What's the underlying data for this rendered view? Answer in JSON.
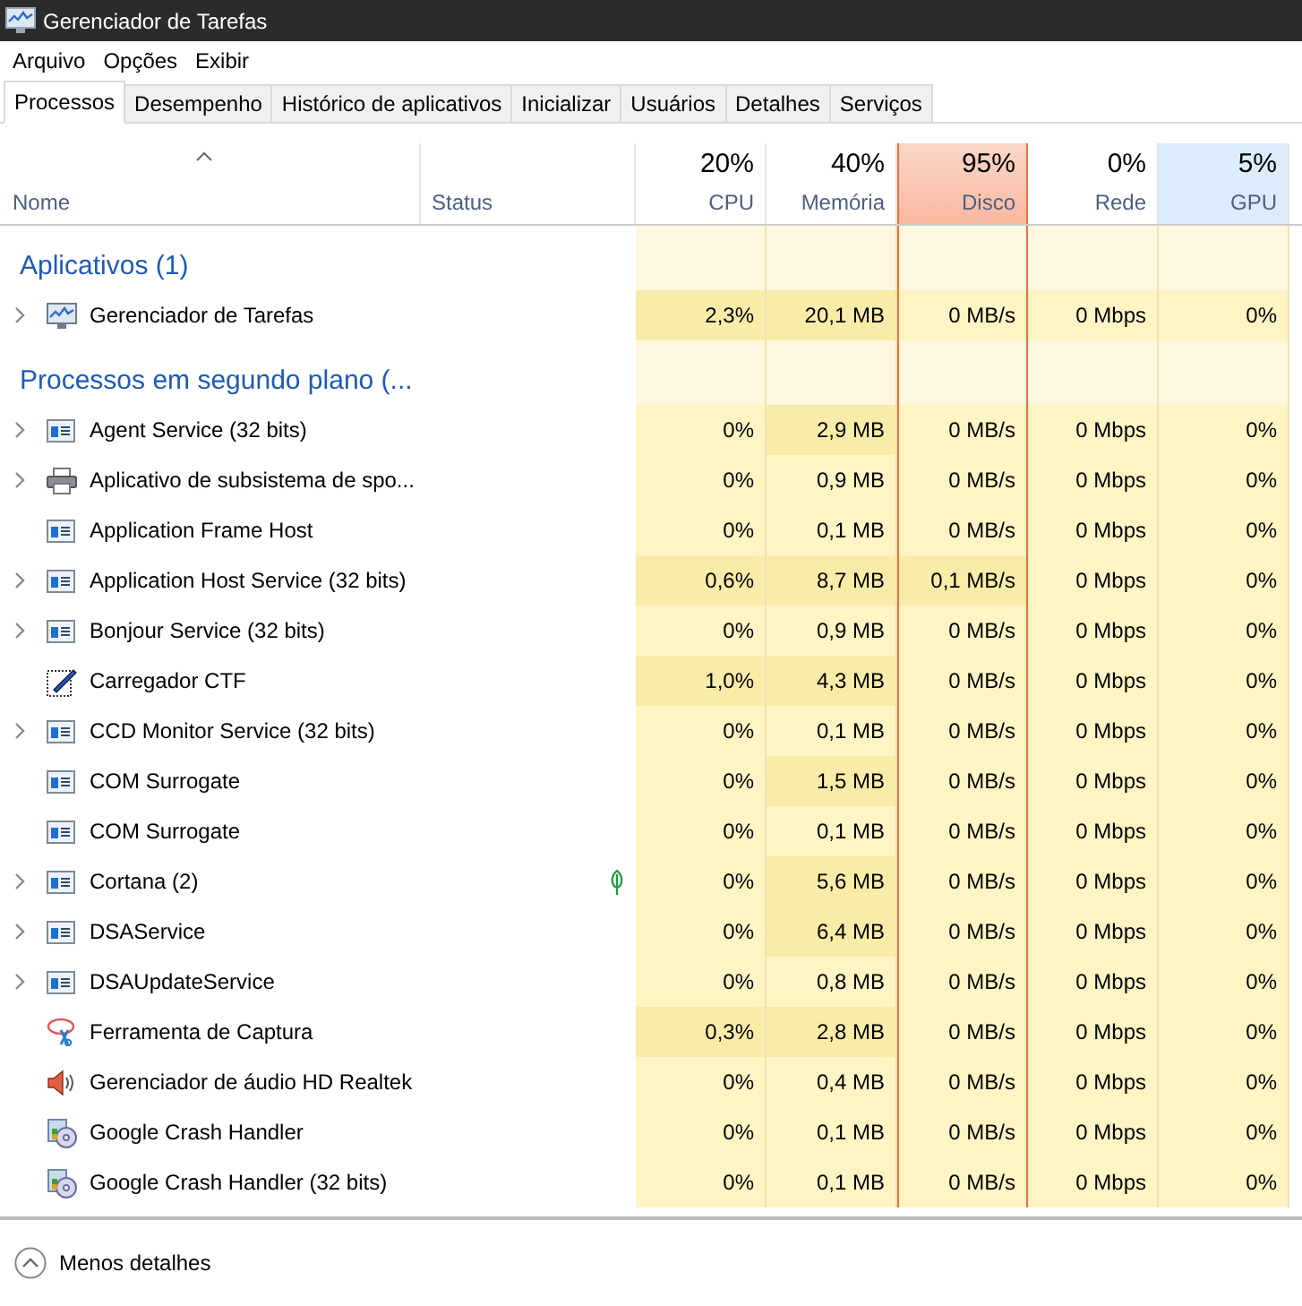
{
  "window": {
    "title": "Gerenciador de Tarefas"
  },
  "menu": [
    "Arquivo",
    "Opções",
    "Exibir"
  ],
  "tabs": [
    {
      "label": "Processos",
      "selected": true
    },
    {
      "label": "Desempenho",
      "selected": false
    },
    {
      "label": "Histórico de aplicativos",
      "selected": false
    },
    {
      "label": "Inicializar",
      "selected": false
    },
    {
      "label": "Usuários",
      "selected": false
    },
    {
      "label": "Detalhes",
      "selected": false
    },
    {
      "label": "Serviços",
      "selected": false
    }
  ],
  "table": {
    "name_column": {
      "label": "Nome",
      "sorted": true
    },
    "status_column": {
      "label": "Status"
    },
    "metric_columns": [
      {
        "percent": "20%",
        "label": "CPU",
        "alert": false,
        "highlighted": false
      },
      {
        "percent": "40%",
        "label": "Memória",
        "alert": false,
        "highlighted": false
      },
      {
        "percent": "95%",
        "label": "Disco",
        "alert": true,
        "highlighted": false
      },
      {
        "percent": "0%",
        "label": "Rede",
        "alert": false,
        "highlighted": false
      },
      {
        "percent": "5%",
        "label": "GPU",
        "alert": false,
        "highlighted": true
      }
    ],
    "groups": [
      {
        "title": "Aplicativos (1)",
        "rows": [
          {
            "name": "Gerenciador de Tarefas",
            "expandable": true,
            "kind": "monitor",
            "cells": [
              {
                "text": "2,3%",
                "highlighted": true
              },
              {
                "text": "20,1 MB",
                "highlighted": true
              },
              {
                "text": "0 MB/s",
                "highlighted": false
              },
              {
                "text": "0 Mbps",
                "highlighted": false
              },
              {
                "text": "0%",
                "highlighted": false
              }
            ]
          }
        ]
      },
      {
        "title": "Processos em segundo plano (...",
        "rows": [
          {
            "name": "Agent Service (32 bits)",
            "expandable": true,
            "kind": "service",
            "cells": [
              {
                "text": "0%",
                "highlighted": false
              },
              {
                "text": "2,9 MB",
                "highlighted": true
              },
              {
                "text": "0 MB/s",
                "highlighted": false
              },
              {
                "text": "0 Mbps",
                "highlighted": false
              },
              {
                "text": "0%",
                "highlighted": false
              }
            ]
          },
          {
            "name": "Aplicativo de subsistema de spo...",
            "expandable": true,
            "kind": "printer",
            "cells": [
              {
                "text": "0%",
                "highlighted": false
              },
              {
                "text": "0,9 MB",
                "highlighted": false
              },
              {
                "text": "0 MB/s",
                "highlighted": false
              },
              {
                "text": "0 Mbps",
                "highlighted": false
              },
              {
                "text": "0%",
                "highlighted": false
              }
            ]
          },
          {
            "name": "Application Frame Host",
            "expandable": false,
            "kind": "service",
            "cells": [
              {
                "text": "0%",
                "highlighted": false
              },
              {
                "text": "0,1 MB",
                "highlighted": false
              },
              {
                "text": "0 MB/s",
                "highlighted": false
              },
              {
                "text": "0 Mbps",
                "highlighted": false
              },
              {
                "text": "0%",
                "highlighted": false
              }
            ]
          },
          {
            "name": "Application Host Service (32 bits)",
            "expandable": true,
            "kind": "service",
            "cells": [
              {
                "text": "0,6%",
                "highlighted": true
              },
              {
                "text": "8,7 MB",
                "highlighted": true
              },
              {
                "text": "0,1 MB/s",
                "highlighted": true
              },
              {
                "text": "0 Mbps",
                "highlighted": false
              },
              {
                "text": "0%",
                "highlighted": false
              }
            ]
          },
          {
            "name": "Bonjour Service (32 bits)",
            "expandable": true,
            "kind": "service",
            "cells": [
              {
                "text": "0%",
                "highlighted": false
              },
              {
                "text": "0,9 MB",
                "highlighted": false
              },
              {
                "text": "0 MB/s",
                "highlighted": false
              },
              {
                "text": "0 Mbps",
                "highlighted": false
              },
              {
                "text": "0%",
                "highlighted": false
              }
            ]
          },
          {
            "name": "Carregador CTF",
            "expandable": false,
            "kind": "pen",
            "cells": [
              {
                "text": "1,0%",
                "highlighted": true
              },
              {
                "text": "4,3 MB",
                "highlighted": true
              },
              {
                "text": "0 MB/s",
                "highlighted": false
              },
              {
                "text": "0 Mbps",
                "highlighted": false
              },
              {
                "text": "0%",
                "highlighted": false
              }
            ]
          },
          {
            "name": "CCD Monitor Service (32 bits)",
            "expandable": true,
            "kind": "service",
            "cells": [
              {
                "text": "0%",
                "highlighted": false
              },
              {
                "text": "0,1 MB",
                "highlighted": false
              },
              {
                "text": "0 MB/s",
                "highlighted": false
              },
              {
                "text": "0 Mbps",
                "highlighted": false
              },
              {
                "text": "0%",
                "highlighted": false
              }
            ]
          },
          {
            "name": "COM Surrogate",
            "expandable": false,
            "kind": "service",
            "cells": [
              {
                "text": "0%",
                "highlighted": false
              },
              {
                "text": "1,5 MB",
                "highlighted": true
              },
              {
                "text": "0 MB/s",
                "highlighted": false
              },
              {
                "text": "0 Mbps",
                "highlighted": false
              },
              {
                "text": "0%",
                "highlighted": false
              }
            ]
          },
          {
            "name": "COM Surrogate",
            "expandable": false,
            "kind": "service",
            "cells": [
              {
                "text": "0%",
                "highlighted": false
              },
              {
                "text": "0,1 MB",
                "highlighted": false
              },
              {
                "text": "0 MB/s",
                "highlighted": false
              },
              {
                "text": "0 Mbps",
                "highlighted": false
              },
              {
                "text": "0%",
                "highlighted": false
              }
            ]
          },
          {
            "name": "Cortana (2)",
            "expandable": true,
            "kind": "service",
            "suspended": true,
            "cells": [
              {
                "text": "0%",
                "highlighted": false
              },
              {
                "text": "5,6 MB",
                "highlighted": true
              },
              {
                "text": "0 MB/s",
                "highlighted": false
              },
              {
                "text": "0 Mbps",
                "highlighted": false
              },
              {
                "text": "0%",
                "highlighted": false
              }
            ]
          },
          {
            "name": "DSAService",
            "expandable": true,
            "kind": "service",
            "cells": [
              {
                "text": "0%",
                "highlighted": false
              },
              {
                "text": "6,4 MB",
                "highlighted": true
              },
              {
                "text": "0 MB/s",
                "highlighted": false
              },
              {
                "text": "0 Mbps",
                "highlighted": false
              },
              {
                "text": "0%",
                "highlighted": false
              }
            ]
          },
          {
            "name": "DSAUpdateService",
            "expandable": true,
            "kind": "service",
            "cells": [
              {
                "text": "0%",
                "highlighted": false
              },
              {
                "text": "0,8 MB",
                "highlighted": false
              },
              {
                "text": "0 MB/s",
                "highlighted": false
              },
              {
                "text": "0 Mbps",
                "highlighted": false
              },
              {
                "text": "0%",
                "highlighted": false
              }
            ]
          },
          {
            "name": "Ferramenta de Captura",
            "expandable": false,
            "kind": "scissors",
            "cells": [
              {
                "text": "0,3%",
                "highlighted": true
              },
              {
                "text": "2,8 MB",
                "highlighted": true
              },
              {
                "text": "0 MB/s",
                "highlighted": false
              },
              {
                "text": "0 Mbps",
                "highlighted": false
              },
              {
                "text": "0%",
                "highlighted": false
              }
            ]
          },
          {
            "name": "Gerenciador de áudio HD Realtek",
            "expandable": false,
            "kind": "speaker",
            "cells": [
              {
                "text": "0%",
                "highlighted": false
              },
              {
                "text": "0,4 MB",
                "highlighted": false
              },
              {
                "text": "0 MB/s",
                "highlighted": false
              },
              {
                "text": "0 Mbps",
                "highlighted": false
              },
              {
                "text": "0%",
                "highlighted": false
              }
            ]
          },
          {
            "name": "Google Crash Handler",
            "expandable": false,
            "kind": "crash",
            "cells": [
              {
                "text": "0%",
                "highlighted": false
              },
              {
                "text": "0,1 MB",
                "highlighted": false
              },
              {
                "text": "0 MB/s",
                "highlighted": false
              },
              {
                "text": "0 Mbps",
                "highlighted": false
              },
              {
                "text": "0%",
                "highlighted": false
              }
            ]
          },
          {
            "name": "Google Crash Handler (32 bits)",
            "expandable": false,
            "kind": "crash",
            "cells": [
              {
                "text": "0%",
                "highlighted": false
              },
              {
                "text": "0,1 MB",
                "highlighted": false
              },
              {
                "text": "0 MB/s",
                "highlighted": false
              },
              {
                "text": "0 Mbps",
                "highlighted": false
              },
              {
                "text": "0%",
                "highlighted": false
              }
            ]
          }
        ]
      }
    ]
  },
  "footer": {
    "label": "Menos detalhes"
  }
}
